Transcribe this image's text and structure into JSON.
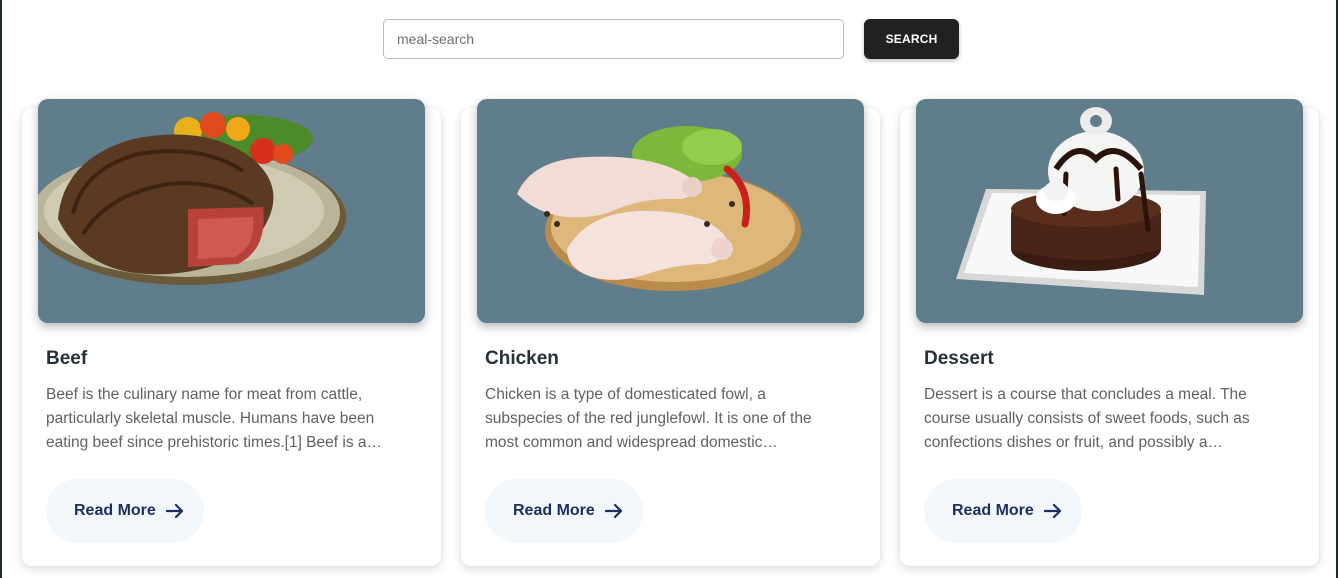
{
  "search": {
    "placeholder": "meal-search",
    "value": "",
    "button_label": "SEARCH"
  },
  "cards": [
    {
      "title": "Beef",
      "image_icon": "beef-steak-image",
      "description": "Beef is the culinary name for meat from cattle, particularly skeletal muscle. Humans have been eating beef since prehistoric times.[1] Beef is a…",
      "button_label": "Read More",
      "button_icon": "arrow-right-icon"
    },
    {
      "title": "Chicken",
      "image_icon": "chicken-legs-image",
      "description": "Chicken is a type of domesticated fowl, a subspecies of the red junglefowl. It is one of the most common and widespread domestic animals,…",
      "button_label": "Read More",
      "button_icon": "arrow-right-icon"
    },
    {
      "title": "Dessert",
      "image_icon": "chocolate-cake-image",
      "description": "Dessert is a course that concludes a meal. The course usually consists of sweet foods, such as confections dishes or fruit, and possibly a beverag…",
      "button_label": "Read More",
      "button_icon": "arrow-right-icon"
    }
  ],
  "colors": {
    "image_background": "#607d8b",
    "button_dark": "#212121",
    "read_more_bg": "#f2f7fc",
    "read_more_text": "#1e2f5e"
  }
}
